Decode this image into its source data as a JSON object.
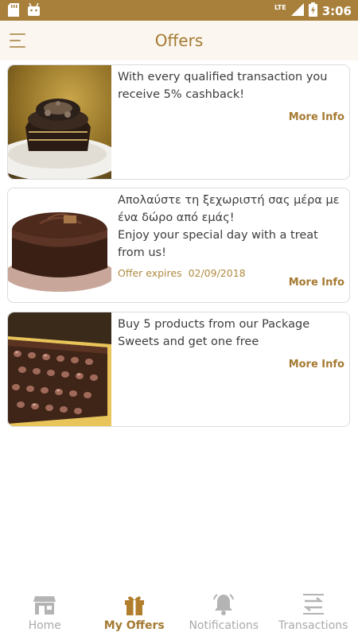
{
  "status_bar": {
    "time": "3:06",
    "network": "LTE",
    "icons": [
      "sd-card-icon",
      "android-icon",
      "signal-icon",
      "battery-charging-icon"
    ]
  },
  "app_bar": {
    "title": "Offers",
    "menu_icon": "hamburger-menu-icon"
  },
  "offers": [
    {
      "image": "chocolate-dessert-photo",
      "description": "With every qualified transaction you receive 5% cashback!",
      "more_label": "More Info"
    },
    {
      "image": "chocolate-cake-photo",
      "description_greek": "Απολαύστε τη ξεχωριστή σας μέρα με ένα δώρο από εμάς!",
      "description": "Enjoy your special day with a treat from us!",
      "expires_label": "Offer expires",
      "expires_date": "02/09/2018",
      "more_label": "More Info"
    },
    {
      "image": "hazelnut-chocolate-bar-photo",
      "description": "Buy 5 products from our Package Sweets and get one free",
      "more_label": "More Info"
    }
  ],
  "bottom_nav": [
    {
      "label": "Home",
      "icon": "store-icon",
      "active": false
    },
    {
      "label": "My Offers",
      "icon": "gift-icon",
      "active": true
    },
    {
      "label": "Notifications",
      "icon": "bell-icon",
      "active": false
    },
    {
      "label": "Transactions",
      "icon": "transfer-arrows-icon",
      "active": false
    }
  ],
  "colors": {
    "status_bar": "#a8803c",
    "app_bar": "#fbf6ef",
    "accent": "#a57a32",
    "inactive": "#aaaaaa"
  }
}
